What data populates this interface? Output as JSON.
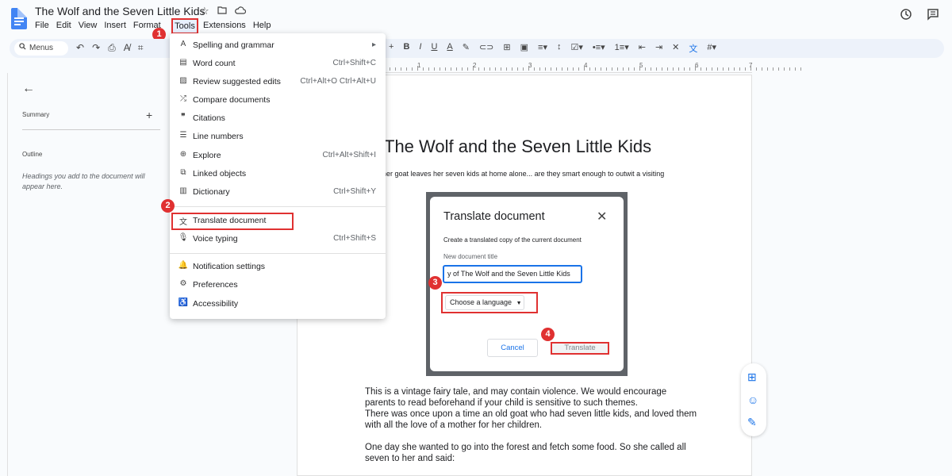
{
  "header": {
    "title": "The Wolf and the Seven Little Kids",
    "menus": [
      "File",
      "Edit",
      "View",
      "Insert",
      "Format"
    ],
    "tools_menu": "Tools",
    "menus_after": [
      "Extensions",
      "Help"
    ]
  },
  "toolbar": {
    "search_label": "Menus"
  },
  "ruler_numbers": [
    "1",
    "2",
    "3",
    "4",
    "5",
    "6",
    "7"
  ],
  "outline_panel": {
    "summary": "Summary",
    "outline": "Outline",
    "hint": "Headings you add to the document will appear here."
  },
  "tools_dropdown": {
    "items": [
      {
        "label": "Spelling and grammar",
        "shortcut": "▸",
        "icon": "spellcheck-icon"
      },
      {
        "label": "Word count",
        "shortcut": "Ctrl+Shift+C",
        "icon": "word-count-icon"
      },
      {
        "label": "Review suggested edits",
        "shortcut": "Ctrl+Alt+O Ctrl+Alt+U",
        "icon": "review-icon"
      },
      {
        "label": "Compare documents",
        "shortcut": "",
        "icon": "compare-icon"
      },
      {
        "label": "Citations",
        "shortcut": "",
        "icon": "quote-icon"
      },
      {
        "label": "Line numbers",
        "shortcut": "",
        "icon": "line-numbers-icon"
      },
      {
        "label": "Explore",
        "shortcut": "Ctrl+Alt+Shift+I",
        "icon": "explore-icon"
      },
      {
        "label": "Linked objects",
        "shortcut": "",
        "icon": "linked-objects-icon"
      },
      {
        "label": "Dictionary",
        "shortcut": "Ctrl+Shift+Y",
        "icon": "dictionary-icon"
      },
      {
        "label": "Translate document",
        "shortcut": "",
        "icon": "translate-icon"
      },
      {
        "label": "Voice typing",
        "shortcut": "Ctrl+Shift+S",
        "icon": "mic-icon"
      },
      {
        "label": "Notification settings",
        "shortcut": "",
        "icon": "bell-icon"
      },
      {
        "label": "Preferences",
        "shortcut": "",
        "icon": "preferences-icon"
      },
      {
        "label": "Accessibility",
        "shortcut": "",
        "icon": "accessibility-icon"
      }
    ]
  },
  "document": {
    "heading": "The Wolf and the Seven Little Kids",
    "subtitle": "her goat leaves her seven kids at home alone... are they smart enough to outwit a visiting",
    "p1_a": "This is a vintage fairy tale, and may contain violence. We would encourage parents to read beforehand if your child is sensitive to such themes.",
    "p1_b": "There was once upon a time an old goat who had seven little kids, and loved them with all the love of a mother for her children.",
    "p2": "One day she wanted to go into the forest and fetch some food. So she called all seven to her and said:"
  },
  "translate_dialog": {
    "title": "Translate document",
    "description": "Create a translated copy of the current document",
    "field_label": "New document title",
    "field_value": "y of The Wolf and the Seven Little Kids",
    "language_button": "Choose a language",
    "cancel": "Cancel",
    "translate": "Translate"
  },
  "badges": [
    "1",
    "2",
    "3",
    "4"
  ],
  "colors": {
    "highlight_red": "#e03131",
    "accent_blue": "#1a73e8",
    "doc_icon_blue": "#4285f4"
  }
}
